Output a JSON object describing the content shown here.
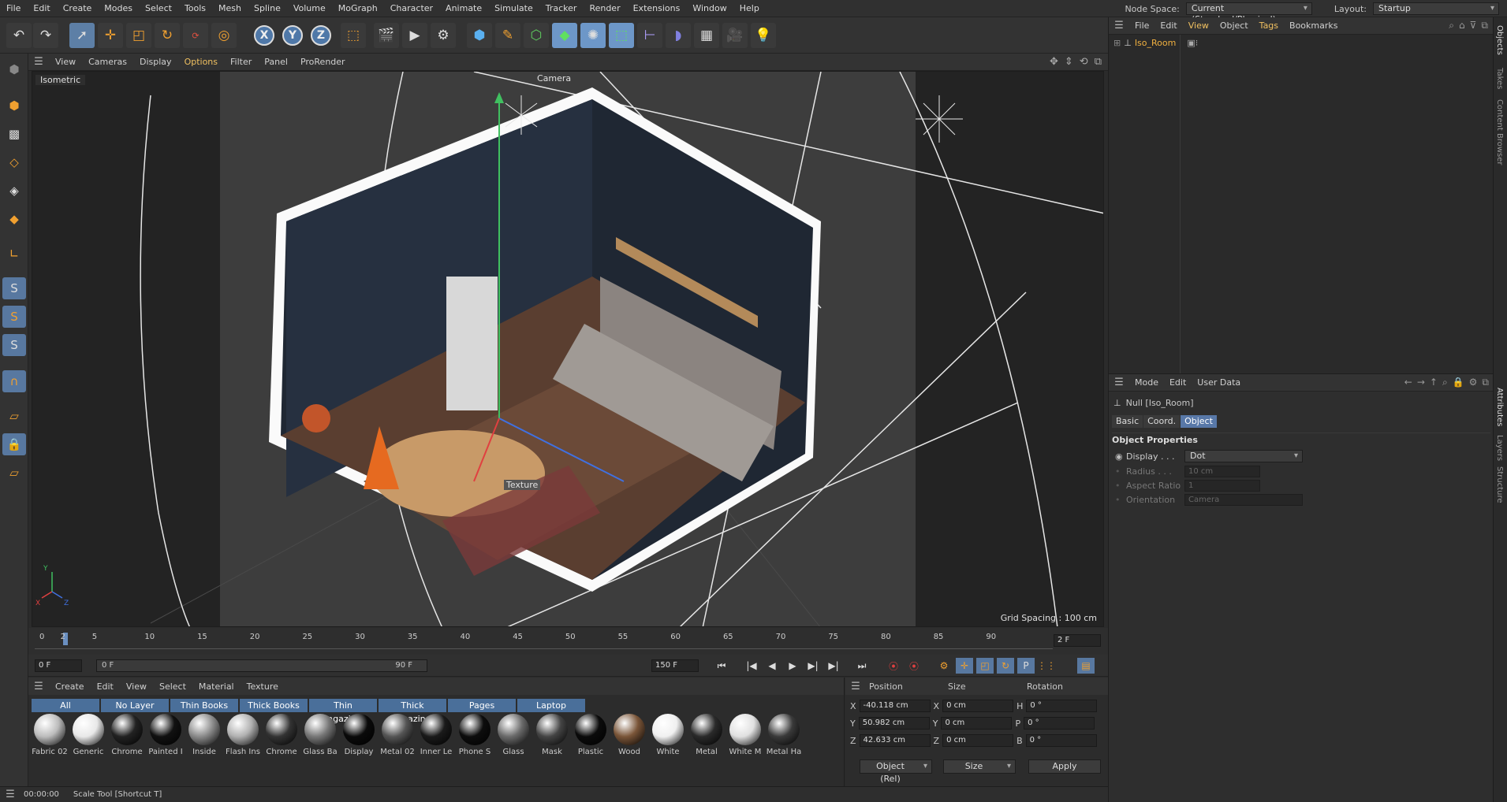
{
  "menu": [
    "File",
    "Edit",
    "Create",
    "Modes",
    "Select",
    "Tools",
    "Mesh",
    "Spline",
    "Volume",
    "MoGraph",
    "Character",
    "Animate",
    "Simulate",
    "Tracker",
    "Render",
    "Extensions",
    "Window",
    "Help"
  ],
  "node_space": {
    "label": "Node Space:",
    "value": "Current (Standard/Physical)"
  },
  "layout": {
    "label": "Layout:",
    "value": "Startup"
  },
  "viewport_menu": [
    "View",
    "Cameras",
    "Display",
    "Options",
    "Filter",
    "Panel",
    "ProRender"
  ],
  "viewport": {
    "name": "Isometric",
    "camera_label": "Camera",
    "texture_label": "Texture",
    "grid_spacing": "Grid Spacing : 100 cm",
    "axis": {
      "x": "X",
      "y": "Y",
      "z": "Z"
    }
  },
  "timeline": {
    "ticks": [
      "0",
      "2",
      "5",
      "10",
      "15",
      "20",
      "25",
      "30",
      "35",
      "40",
      "45",
      "50",
      "55",
      "60",
      "65",
      "70",
      "75",
      "80",
      "85",
      "90"
    ],
    "current_frame": "2 F",
    "start": "0 F",
    "range_start": "0 F",
    "range_end": "90 F",
    "end": "150 F"
  },
  "material_menu": [
    "Create",
    "Edit",
    "View",
    "Select",
    "Material",
    "Texture"
  ],
  "material_tags": [
    "All",
    "No Layer",
    "Thin Books",
    "Thick Books",
    "Thin Magazines",
    "Thick Magazines",
    "Pages",
    "Laptop"
  ],
  "materials": [
    {
      "name": "Fabric 02",
      "color": "#bcbcbc"
    },
    {
      "name": "Generic",
      "color": "#e8e8e8"
    },
    {
      "name": "Chrome",
      "color": "#222"
    },
    {
      "name": "Painted I",
      "color": "#111"
    },
    {
      "name": "Inside",
      "color": "#8a8a8a"
    },
    {
      "name": "Flash Ins",
      "color": "#b0b0b0"
    },
    {
      "name": "Chrome",
      "color": "#333"
    },
    {
      "name": "Glass Ba",
      "color": "#777"
    },
    {
      "name": "Display",
      "color": "#0a0a0a"
    },
    {
      "name": "Metal 02",
      "color": "#555"
    },
    {
      "name": "Inner Le",
      "color": "#1a1a1a"
    },
    {
      "name": "Phone S",
      "color": "#0d0d0d"
    },
    {
      "name": "Glass",
      "color": "#6a6a6a"
    },
    {
      "name": "Mask",
      "color": "#444"
    },
    {
      "name": "Plastic",
      "color": "#0b0b0b"
    },
    {
      "name": "Wood",
      "color": "#7a5538"
    },
    {
      "name": "White",
      "color": "#f0f0f0"
    },
    {
      "name": "Metal",
      "color": "#2a2a2a"
    },
    {
      "name": "White M",
      "color": "#e0e0e0"
    },
    {
      "name": "Metal Ha",
      "color": "#3a3a3a"
    }
  ],
  "coords": {
    "headers": [
      "Position",
      "Size",
      "Rotation"
    ],
    "rows": [
      {
        "axis": "X",
        "pos": "-40.118 cm",
        "saxis": "X",
        "size": "0 cm",
        "raxis": "H",
        "rot": "0 °"
      },
      {
        "axis": "Y",
        "pos": "50.982 cm",
        "saxis": "Y",
        "size": "0 cm",
        "raxis": "P",
        "rot": "0 °"
      },
      {
        "axis": "Z",
        "pos": "42.633 cm",
        "saxis": "Z",
        "size": "0 cm",
        "raxis": "B",
        "rot": "0 °"
      }
    ],
    "mode": "Object (Rel)",
    "size_mode": "Size",
    "apply": "Apply"
  },
  "status": {
    "time": "00:00:00",
    "message": "Scale Tool [Shortcut T]"
  },
  "objects_menu": [
    "File",
    "Edit",
    "View",
    "Object",
    "Tags",
    "Bookmarks"
  ],
  "objects": [
    {
      "name": "Iso_Room"
    }
  ],
  "attributes_menu": [
    "Mode",
    "Edit",
    "User Data"
  ],
  "attributes": {
    "title": "Null [Iso_Room]",
    "tabs": [
      "Basic",
      "Coord.",
      "Object"
    ],
    "section": "Object Properties",
    "props": [
      {
        "label": "Display . . .",
        "value": "Dot",
        "enabled": true
      },
      {
        "label": "Radius . . .",
        "value": "10 cm",
        "enabled": false
      },
      {
        "label": "Aspect Ratio",
        "value": "1",
        "enabled": false
      },
      {
        "label": "Orientation",
        "value": "Camera",
        "enabled": false
      }
    ]
  },
  "side_tabs": [
    "Objects",
    "Takes",
    "Content Browser",
    "Attributes",
    "Layers",
    "Structure"
  ],
  "colors": {
    "accent": "#5878a8",
    "highlight": "#f0c060"
  }
}
